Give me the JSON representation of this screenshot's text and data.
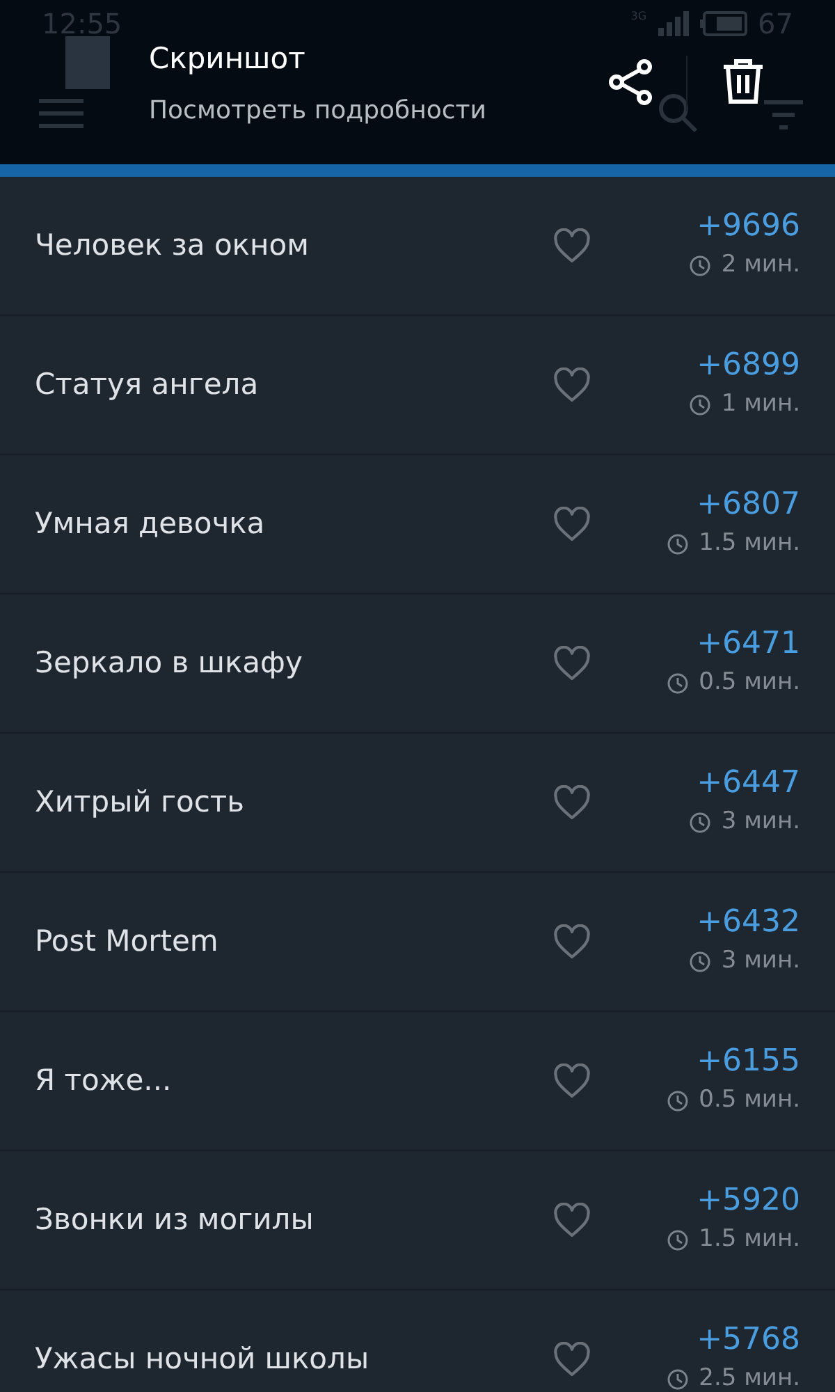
{
  "status_bar": {
    "time": "12:55",
    "network": "3G",
    "battery": "67"
  },
  "notification": {
    "title": "Скриншот",
    "subtitle": "Посмотреть подробности"
  },
  "stories": [
    {
      "title": "Человек за окном",
      "favorite": false,
      "score": "+9696",
      "time": "2 мин."
    },
    {
      "title": "Статуя ангела",
      "favorite": false,
      "score": "+6899",
      "time": "1 мин."
    },
    {
      "title": "Умная девочка",
      "favorite": false,
      "score": "+6807",
      "time": "1.5 мин."
    },
    {
      "title": "Зеркало в шкафу",
      "favorite": false,
      "score": "+6471",
      "time": "0.5 мин."
    },
    {
      "title": "Хитрый гость",
      "favorite": false,
      "score": "+6447",
      "time": "3 мин."
    },
    {
      "title": "Post Mortem",
      "favorite": false,
      "score": "+6432",
      "time": "3 мин."
    },
    {
      "title": "Я тоже...",
      "favorite": false,
      "score": "+6155",
      "time": "0.5 мин."
    },
    {
      "title": "Звонки из могилы",
      "favorite": false,
      "score": "+5920",
      "time": "1.5 мин."
    },
    {
      "title": "Ужасы ночной школы",
      "favorite": false,
      "score": "+5768",
      "time": "2.5 мин."
    }
  ]
}
